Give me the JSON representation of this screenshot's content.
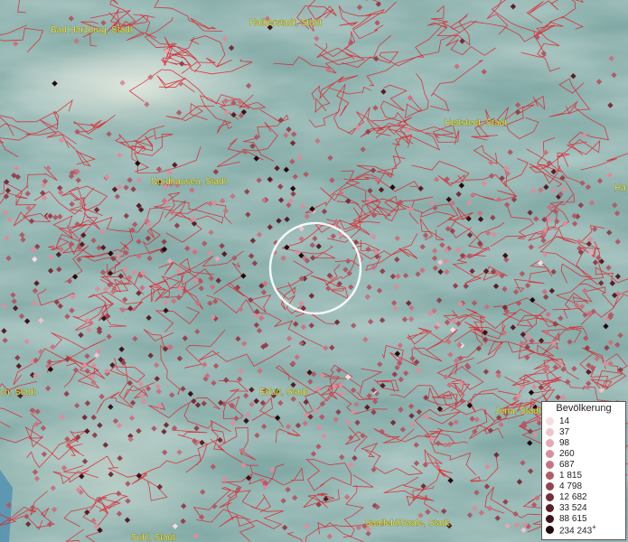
{
  "map": {
    "colors": {
      "terrain": "#7fa9a6",
      "boundary": "#e0202a"
    },
    "place_labels": [
      {
        "text": "Bad Harzburg, Stadt"
      },
      {
        "text": "Halberstadt, Stadt"
      },
      {
        "text": "Hettstedt, Stadt"
      },
      {
        "text": "Nordhausen, Stadt"
      },
      {
        "text": "Erfurt, Stadt"
      },
      {
        "text": "Jena, Stadt"
      },
      {
        "text": "Saalfeld/Saale, Stadt"
      },
      {
        "text": "Suhl, Stadt"
      },
      {
        "text": "ch, Stadt"
      },
      {
        "text": "Ha"
      }
    ]
  },
  "legend": {
    "title": "Bevölkerung",
    "items": [
      {
        "label": "14",
        "color": "#f7dde3"
      },
      {
        "label": "37",
        "color": "#f0c4cc"
      },
      {
        "label": "98",
        "color": "#e6a8b3"
      },
      {
        "label": "260",
        "color": "#d98f9b"
      },
      {
        "label": "687",
        "color": "#c77580"
      },
      {
        "label": "1 815",
        "color": "#b05b66"
      },
      {
        "label": "4 798",
        "color": "#94424d"
      },
      {
        "label": "12 682",
        "color": "#772e38"
      },
      {
        "label": "33 524",
        "color": "#5a1e26"
      },
      {
        "label": "88 615",
        "color": "#3e1218"
      },
      {
        "label": "234 243",
        "color": "#25080d",
        "plus": "+"
      }
    ]
  }
}
